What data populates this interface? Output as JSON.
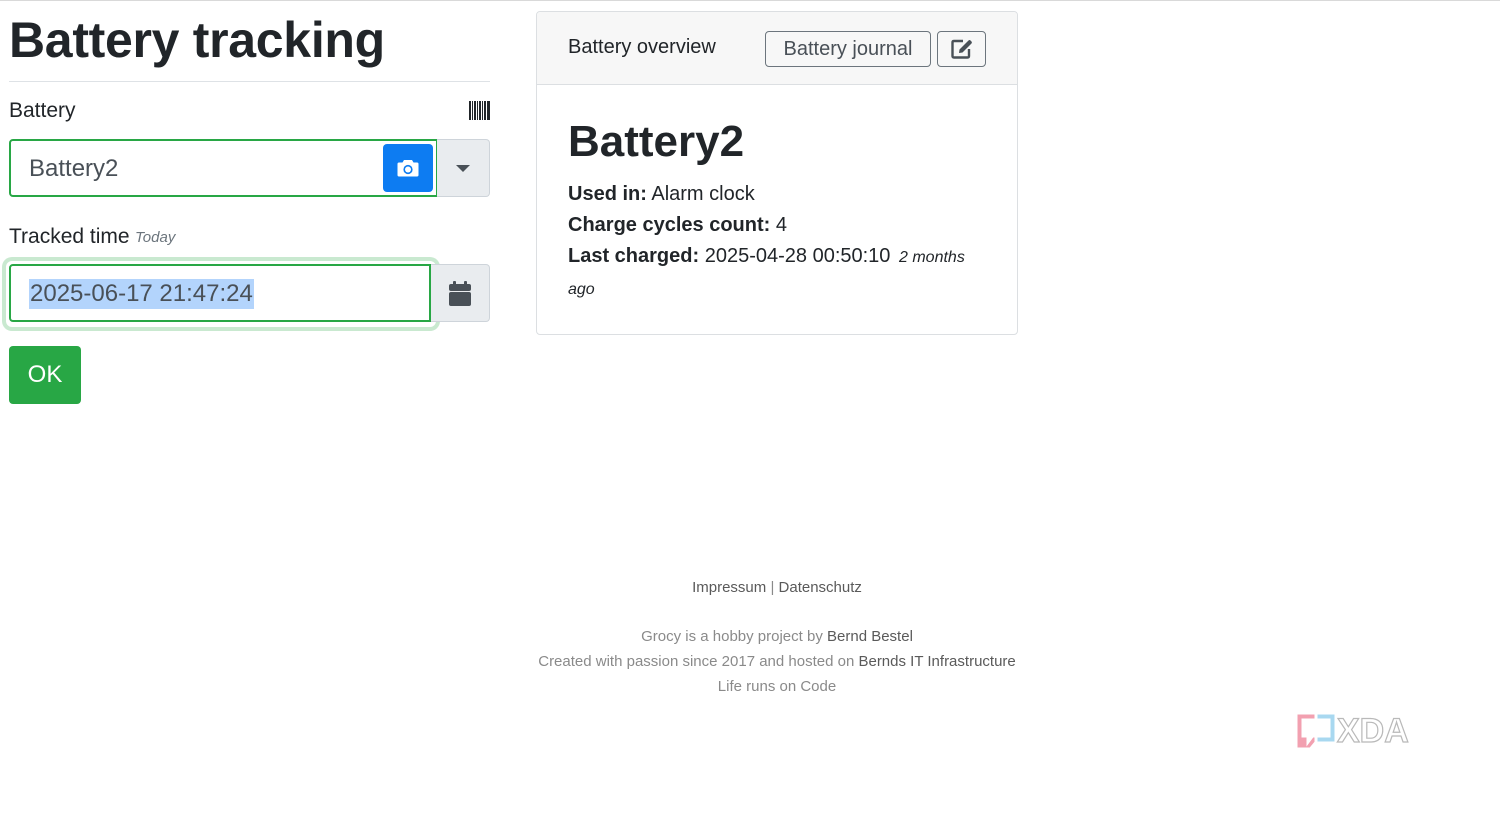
{
  "page": {
    "title": "Battery tracking"
  },
  "form": {
    "battery_label": "Battery",
    "battery_value": "Battery2",
    "tracked_time_label": "Tracked time",
    "tracked_time_hint": "Today",
    "tracked_time_value": "2025-06-17 21:47:24",
    "ok_label": "OK"
  },
  "card": {
    "header_title": "Battery overview",
    "journal_button": "Battery journal",
    "battery_name": "Battery2",
    "used_in_label": "Used in:",
    "used_in_value": "Alarm clock",
    "cycles_label": "Charge cycles count:",
    "cycles_value": "4",
    "last_charged_label": "Last charged:",
    "last_charged_value": "2025-04-28 00:50:10",
    "last_charged_relative_1": "2 months",
    "last_charged_relative_2": "ago"
  },
  "footer": {
    "impressum": "Impressum",
    "separator": "|",
    "datenschutz": "Datenschutz",
    "hobby_prefix": "Grocy is a hobby project by",
    "author": "Bernd Bestel",
    "created_prefix": "Created with passion since 2017 and hosted on",
    "hosting": "Bernds IT Infrastructure",
    "tagline": "Life runs on Code"
  },
  "watermark": {
    "text": "XDA"
  },
  "icons": {
    "barcode": "barcode-icon",
    "camera": "camera-icon",
    "dropdown": "caret-down-icon",
    "calendar": "calendar-icon",
    "edit": "edit-icon"
  },
  "colors": {
    "success": "#28a745",
    "primary": "#0d7cf2",
    "selection": "#b3d4fc",
    "addon_bg": "#e9ecef"
  }
}
